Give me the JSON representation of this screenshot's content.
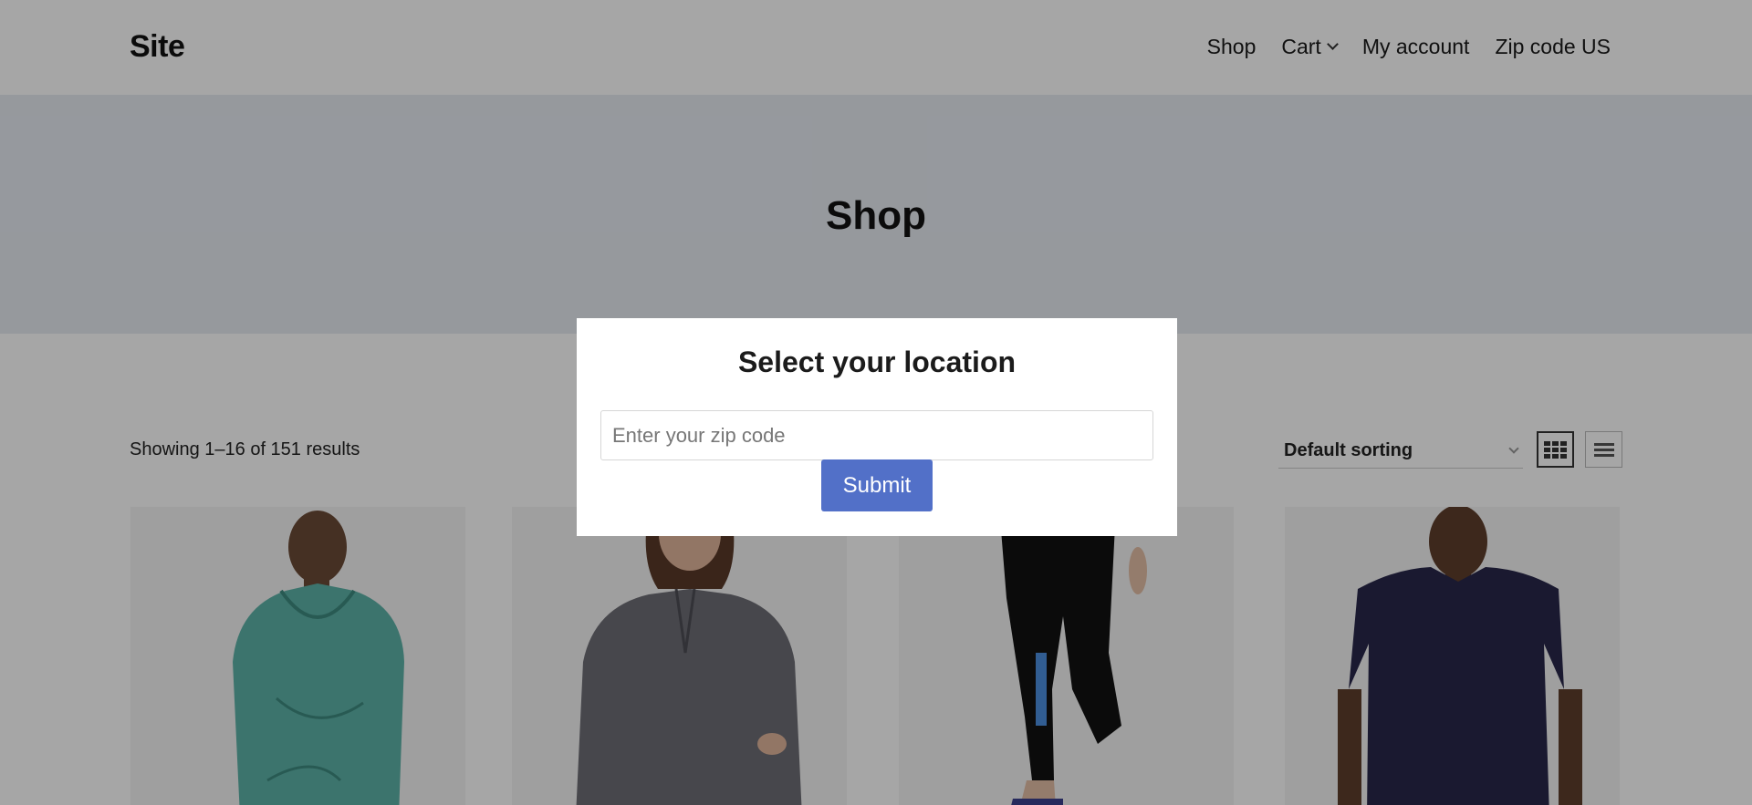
{
  "header": {
    "brand": "Site",
    "nav": [
      {
        "label": "Shop"
      },
      {
        "label": "Cart"
      },
      {
        "label": "My account"
      },
      {
        "label": "Zip code US"
      }
    ]
  },
  "hero": {
    "title": "Shop"
  },
  "toolbar": {
    "results_text": "Showing 1–16 of 151 results",
    "sort_selected": "Default sorting"
  },
  "modal": {
    "title": "Select your location",
    "input_placeholder": "Enter your zip code",
    "submit_label": "Submit"
  },
  "colors": {
    "accent": "#5270c8",
    "hero_bg": "#e7ebf2",
    "overlay": "rgba(0,0,0,0.35)"
  }
}
